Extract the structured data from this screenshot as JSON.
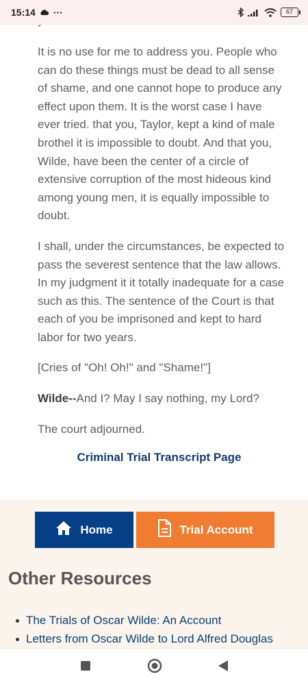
{
  "status_bar": {
    "time": "15:14",
    "extra": "···",
    "battery": "67",
    "icons": [
      "cloud-icon",
      "bluetooth-icon",
      "signal-icon",
      "wifi-icon",
      "battery-icon"
    ]
  },
  "article": {
    "cut_line": "you.",
    "paragraphs": [
      "It is no use for me to address you. People who can do these things must be dead to all sense of shame, and one cannot hope to produce any effect upon them. It is the worst case I have ever tried. that you, Taylor, kept a kind of male brothel it is impossible to doubt. And that you, Wilde, have been the center of a circle of extensive corruption of the most hideous kind among young men, it is equally impossible to doubt.",
      "I shall, under the circumstances, be expected to pass the severest sentence that the law allows. In my judgment it it totally inadequate for a case such as this. The sentence of the Court is that each of you be imprisoned and kept to hard labor for two years.",
      "[Cries of \"Oh! Oh!\" and \"Shame!\"]"
    ],
    "speaker": "Wilde--",
    "speaker_text": "And I? May I say nothing, my Lord?",
    "closing": "The court adjourned.",
    "transcript_link": "Criminal Trial Transcript Page"
  },
  "buttons": {
    "home_label": "Home",
    "trial_label": "Trial Account"
  },
  "resources": {
    "title": "Other Resources",
    "items": [
      "The Trials of Oscar Wilde: An Account",
      "Letters from Oscar Wilde to Lord Alfred Douglas"
    ]
  },
  "colors": {
    "link": "#123c6e",
    "home_button": "#063f85",
    "trial_button": "#ef7c31",
    "footer_bg": "#faf4ec",
    "status_bg": "#fbefef"
  }
}
